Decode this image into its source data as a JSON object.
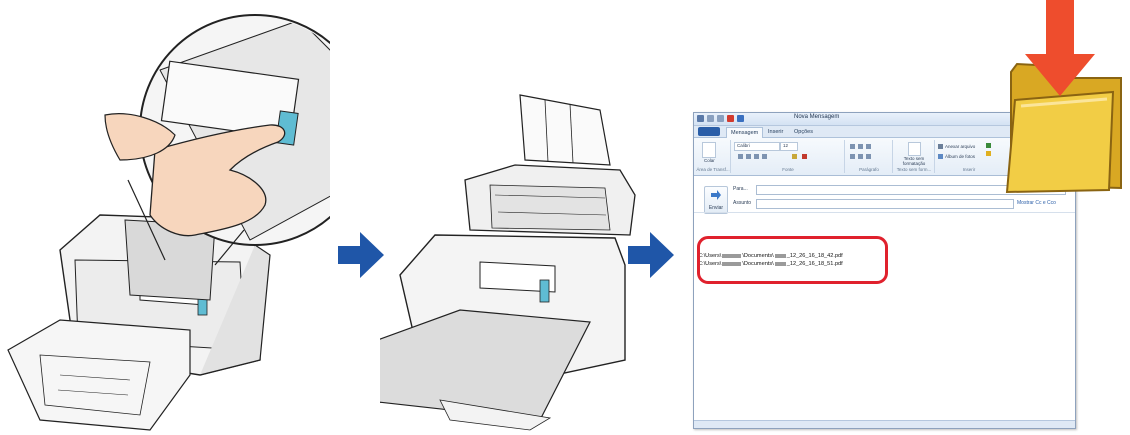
{
  "email_window": {
    "title": "Nova Mensagem",
    "tabs": {
      "file": "",
      "message": "Mensagem",
      "insert": "Inserir",
      "options": "Opções"
    },
    "ribbon": {
      "paste": "Colar",
      "font_name": "Calibri",
      "font_size": "12",
      "clipboard_group": "Área de Transf...",
      "font_group": "Fonte",
      "paragraph_group": "Parágrafo",
      "plain_text_button": "Texto sem formatação",
      "plain_text_group": "Texto sem form...",
      "attach_file": "Anexar arquivo",
      "photo_album": "Álbum de fotos",
      "insert_group": "Inserir"
    },
    "send_label": "Enviar",
    "to_label": "Para...",
    "subject_label": "Assunto",
    "cc_link": "Mostrar Cc e Cco",
    "attachments": [
      {
        "prefix": "C:\\Users\\",
        "middle": "\\Documents\\",
        "suffix": "_12_26_16_18_42.pdf"
      },
      {
        "prefix": "C:\\Users\\",
        "middle": "\\Documents\\",
        "suffix": "_12_26_16_18_51.pdf"
      }
    ]
  },
  "colors": {
    "flow_arrow": "#1f56a8",
    "highlight": "#e0212d",
    "folder": "#f2cd45",
    "drop_arrow": "#ee4d2d",
    "scan_button": "#5fbcd3"
  },
  "icons": [
    "scanner-press-icon",
    "scanner-output-icon",
    "flow-arrow-icon",
    "folder-icon",
    "drop-arrow-icon",
    "send-icon"
  ]
}
